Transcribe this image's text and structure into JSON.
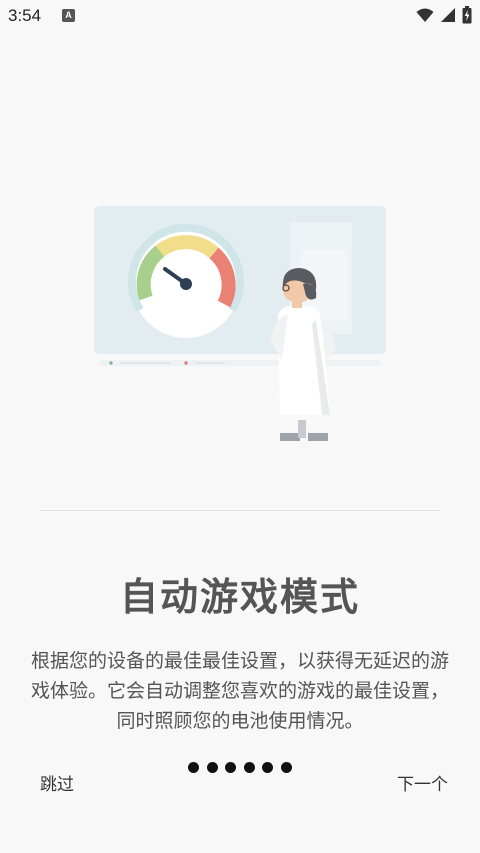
{
  "status_bar": {
    "time": "3:54",
    "notification_badge": "A",
    "icons": [
      "wifi-icon",
      "cell-signal-icon",
      "battery-charging-icon"
    ]
  },
  "onboarding": {
    "title": "自动游戏模式",
    "description": "根据您的设备的最佳最佳设置，以获得无延迟的游戏体验。它会自动调整您喜欢的游戏的最佳设置，同时照顾您的电池使用情况。",
    "skip_label": "跳过",
    "next_label": "下一个",
    "page_count": 6,
    "current_page": 1
  }
}
